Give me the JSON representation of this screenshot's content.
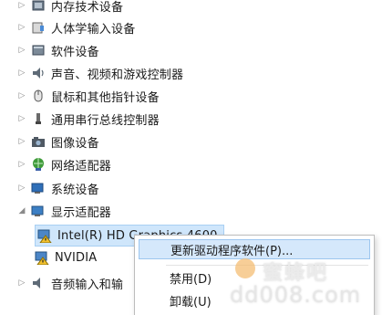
{
  "tree": {
    "items": [
      {
        "label": "内存技术设备",
        "icon": "memory-device-icon",
        "expand": "▷"
      },
      {
        "label": "人体学输入设备",
        "icon": "hid-device-icon",
        "expand": "▷"
      },
      {
        "label": "软件设备",
        "icon": "software-device-icon",
        "expand": "▷"
      },
      {
        "label": "声音、视频和游戏控制器",
        "icon": "speaker-icon",
        "expand": "▷"
      },
      {
        "label": "鼠标和其他指针设备",
        "icon": "mouse-icon",
        "expand": "▷"
      },
      {
        "label": "通用串行总线控制器",
        "icon": "usb-icon",
        "expand": "▷"
      },
      {
        "label": "图像设备",
        "icon": "camera-device-icon",
        "expand": "▷"
      },
      {
        "label": "网络适配器",
        "icon": "network-adapter-icon",
        "expand": "▷"
      },
      {
        "label": "系统设备",
        "icon": "system-device-icon",
        "expand": "▷"
      },
      {
        "label": "显示适配器",
        "icon": "display-adapter-icon",
        "expand": "◢"
      }
    ],
    "children": [
      {
        "label": "Intel(R) HD Graphics 4600",
        "icon": "warning-display-icon"
      },
      {
        "label": "NVIDIA",
        "icon": "warning-display-icon"
      }
    ],
    "after": {
      "label": "音频输入和输",
      "icon": "audio-io-icon",
      "expand": "▷"
    }
  },
  "context_menu": {
    "items": [
      {
        "label": "更新驱动程序软件(P)..."
      },
      {
        "label": "禁用(D)"
      },
      {
        "label": "卸载(U)"
      }
    ]
  },
  "watermark": {
    "brand": "蜜蜂吧",
    "url": "dd008.com"
  }
}
